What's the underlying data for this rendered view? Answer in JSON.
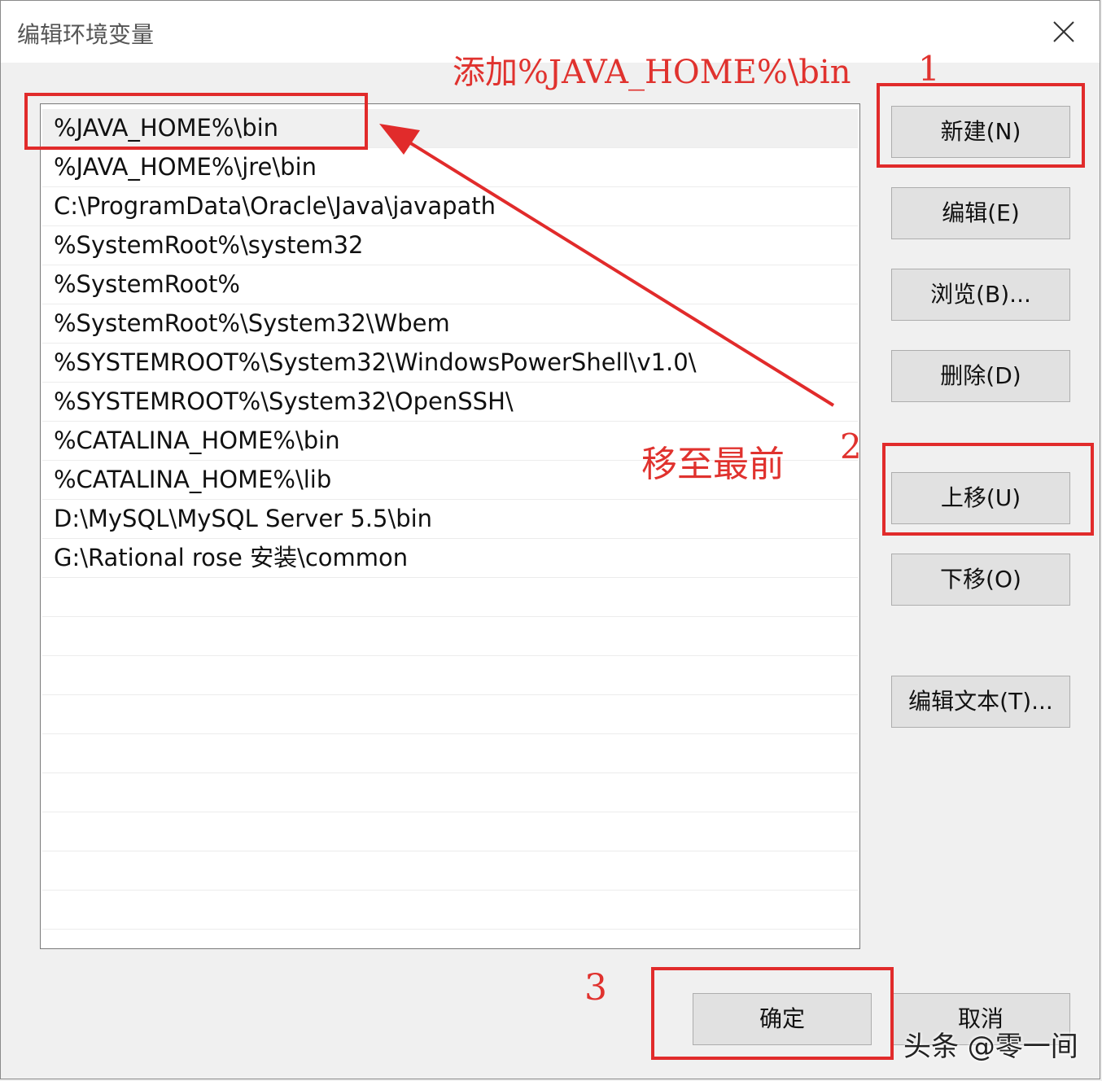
{
  "window": {
    "title": "编辑环境变量",
    "close_icon": "close-icon"
  },
  "paths": [
    "%JAVA_HOME%\\bin",
    "%JAVA_HOME%\\jre\\bin",
    "C:\\ProgramData\\Oracle\\Java\\javapath",
    "%SystemRoot%\\system32",
    "%SystemRoot%",
    "%SystemRoot%\\System32\\Wbem",
    "%SYSTEMROOT%\\System32\\WindowsPowerShell\\v1.0\\",
    "%SYSTEMROOT%\\System32\\OpenSSH\\",
    "%CATALINA_HOME%\\bin",
    "%CATALINA_HOME%\\lib",
    "D:\\MySQL\\MySQL Server 5.5\\bin",
    "G:\\Rational rose 安装\\common"
  ],
  "selected_index": 0,
  "buttons": {
    "new": "新建(N)",
    "edit": "编辑(E)",
    "browse": "浏览(B)...",
    "delete": "删除(D)",
    "move_up": "上移(U)",
    "move_down": "下移(O)",
    "edit_text": "编辑文本(T)...",
    "ok": "确定",
    "cancel": "取消"
  },
  "annotations": {
    "add_note": "添加%JAVA_HOME%\\bin",
    "move_note": "移至最前",
    "step1": "1",
    "step2": "2",
    "step3": "3",
    "color": "#e0322e"
  },
  "watermark": "头条 @零一间"
}
